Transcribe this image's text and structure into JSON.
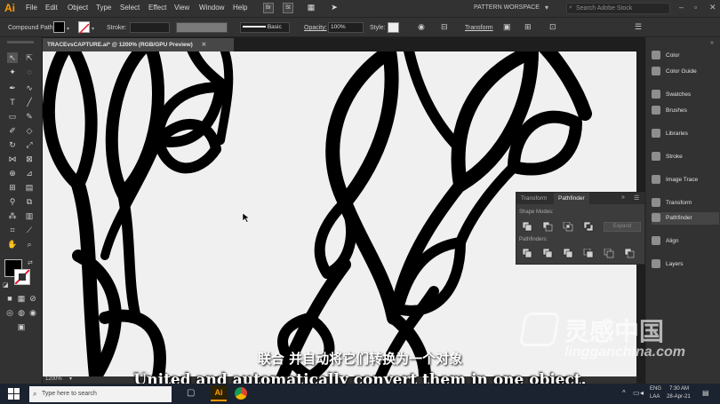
{
  "app": {
    "logo": "Ai",
    "workspace": "PATTERN WORSPACE",
    "search_placeholder": "Search Adobe Stock"
  },
  "menu": [
    "File",
    "Edit",
    "Object",
    "Type",
    "Select",
    "Effect",
    "View",
    "Window",
    "Help"
  ],
  "menubar_icons": [
    "Br",
    "St"
  ],
  "control": {
    "object_type": "Compound Path",
    "stroke_label": "Stroke:",
    "brush_label": "Basic",
    "opacity_label": "Opacity:",
    "opacity_value": "100%",
    "style_label": "Style:",
    "transform_link": "Transform"
  },
  "document": {
    "tab_title": "TRACEvsCAPTURE.ai* @ 1200% (RGB/GPU Preview)",
    "zoom": "1200%"
  },
  "right_panels": [
    "Color",
    "Color Guide",
    "Swatches",
    "Brushes",
    "Libraries",
    "Stroke",
    "Image Trace",
    "Transform",
    "Pathfinder",
    "Align",
    "Layers"
  ],
  "pathfinder_panel": {
    "tabs": [
      "Transform",
      "Pathfinder"
    ],
    "shape_modes_label": "Shape Modes:",
    "pathfinders_label": "Pathfinders:",
    "expand_label": "Expand"
  },
  "subtitles": {
    "chinese": "联合 并自动将它们转换为一个对象",
    "english": "United and automatically convert them in one object."
  },
  "watermark": {
    "text": "灵感中国",
    "url": "lingganchina.com"
  },
  "taskbar": {
    "search_placeholder": "Type here to search",
    "lang": "ENG",
    "region": "LAA",
    "time": "7:30 AM",
    "date": "28-Apr-21"
  },
  "colors": {
    "accent": "#ff9a00",
    "panel_bg": "#323232",
    "canvas_bg": "#f0f0f0"
  }
}
